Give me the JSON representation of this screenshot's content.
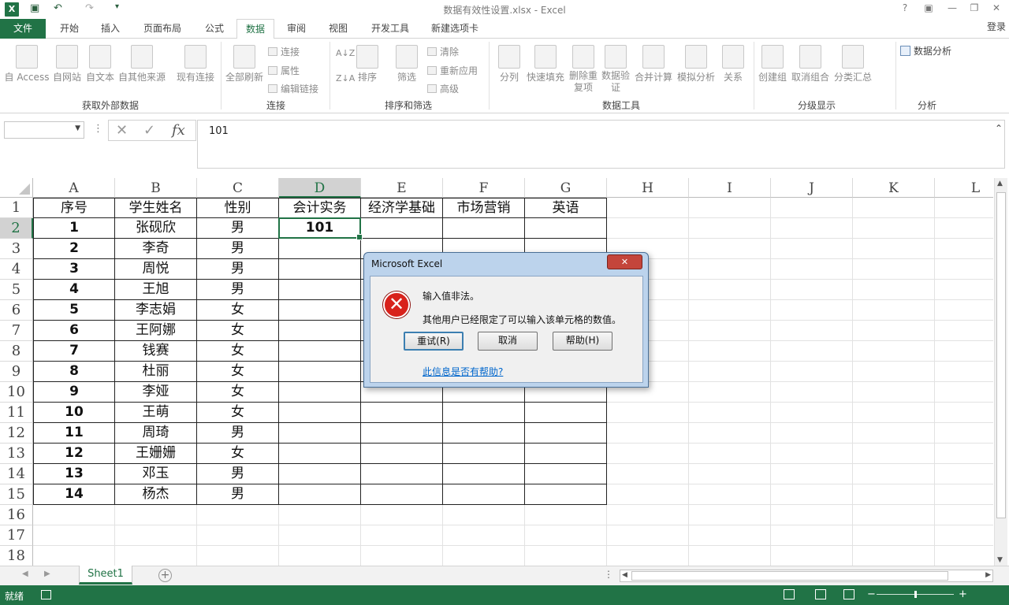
{
  "titlebar": {
    "title": "数据有效性设置.xlsx - Excel",
    "logo": "X",
    "help_glyph": "?",
    "ribbon_display_glyph": "▣",
    "minimize_glyph": "—",
    "restore_glyph": "❐",
    "close_glyph": "✕",
    "quick_access": {
      "save_icon": "save-icon",
      "undo_icon": "undo-icon",
      "redo_icon": "redo-icon",
      "customize_icon": "customize-qa-icon"
    }
  },
  "tabs": {
    "file": "文件",
    "items": [
      "开始",
      "插入",
      "页面布局",
      "公式",
      "数据",
      "审阅",
      "视图",
      "开发工具",
      "新建选项卡"
    ],
    "active": "数据",
    "login": "登录"
  },
  "ribbon": {
    "get_external": {
      "label": "获取外部数据",
      "buttons": [
        "自 Access",
        "自网站",
        "自文本",
        "自其他来源",
        "现有连接"
      ]
    },
    "connections": {
      "label": "连接",
      "refresh_all": "全部刷新",
      "small": [
        "连接",
        "属性",
        "编辑链接"
      ]
    },
    "sort_filter": {
      "label": "排序和筛选",
      "sort": "排序",
      "filter": "筛选",
      "small": [
        "清除",
        "重新应用",
        "高级"
      ]
    },
    "data_tools": {
      "label": "数据工具",
      "buttons": [
        "分列",
        "快速填充",
        "删除重复项",
        "数据验证",
        "合并计算",
        "模拟分析",
        "关系"
      ]
    },
    "outline": {
      "label": "分级显示",
      "buttons": [
        "创建组",
        "取消组合",
        "分类汇总"
      ]
    },
    "analysis": {
      "label": "分析",
      "data_analysis": "数据分析"
    }
  },
  "formula_bar": {
    "name_box": "",
    "formula": "101",
    "fx_label": "fx",
    "cancel_glyph": "✕",
    "enter_glyph": "✓"
  },
  "columns": [
    "A",
    "B",
    "C",
    "D",
    "E",
    "F",
    "G",
    "H",
    "I",
    "J",
    "K",
    "L"
  ],
  "selected_column": "D",
  "selected_row": 2,
  "table": {
    "headers": [
      "序号",
      "学生姓名",
      "性别",
      "会计实务",
      "经济学基础",
      "市场营销",
      "英语"
    ],
    "rows": [
      [
        "1",
        "张砚欣",
        "男",
        "101",
        "",
        "",
        ""
      ],
      [
        "2",
        "李奇",
        "男",
        "",
        "",
        "",
        ""
      ],
      [
        "3",
        "周悦",
        "男",
        "",
        "",
        "",
        ""
      ],
      [
        "4",
        "王旭",
        "男",
        "",
        "",
        "",
        ""
      ],
      [
        "5",
        "李志娟",
        "女",
        "",
        "",
        "",
        ""
      ],
      [
        "6",
        "王阿娜",
        "女",
        "",
        "",
        "",
        ""
      ],
      [
        "7",
        "钱赛",
        "女",
        "",
        "",
        "",
        ""
      ],
      [
        "8",
        "杜丽",
        "女",
        "",
        "",
        "",
        ""
      ],
      [
        "9",
        "李娅",
        "女",
        "",
        "",
        "",
        ""
      ],
      [
        "10",
        "王萌",
        "女",
        "",
        "",
        "",
        ""
      ],
      [
        "11",
        "周琦",
        "男",
        "",
        "",
        "",
        ""
      ],
      [
        "12",
        "王姗姗",
        "女",
        "",
        "",
        "",
        ""
      ],
      [
        "13",
        "邓玉",
        "男",
        "",
        "",
        "",
        ""
      ],
      [
        "14",
        "杨杰",
        "男",
        "",
        "",
        "",
        ""
      ]
    ],
    "extra_rows": [
      16,
      17,
      18
    ]
  },
  "sheet_tabs": {
    "active": "Sheet1",
    "add": "+"
  },
  "status": {
    "ready": "就绪",
    "zoom_minus": "−",
    "zoom_plus": "+"
  },
  "dialog": {
    "title": "Microsoft Excel",
    "close_glyph": "✕",
    "icon": "error-icon",
    "icon_glyph": "✕",
    "message1": "输入值非法。",
    "message2": "其他用户已经限定了可以输入该单元格的数值。",
    "retry": "重试(R)",
    "cancel": "取消",
    "help": "帮助(H)",
    "help_link": "此信息是否有帮助?"
  },
  "colors": {
    "excel_green": "#217346",
    "error_red": "#d8221c",
    "link_blue": "#0066cc"
  }
}
